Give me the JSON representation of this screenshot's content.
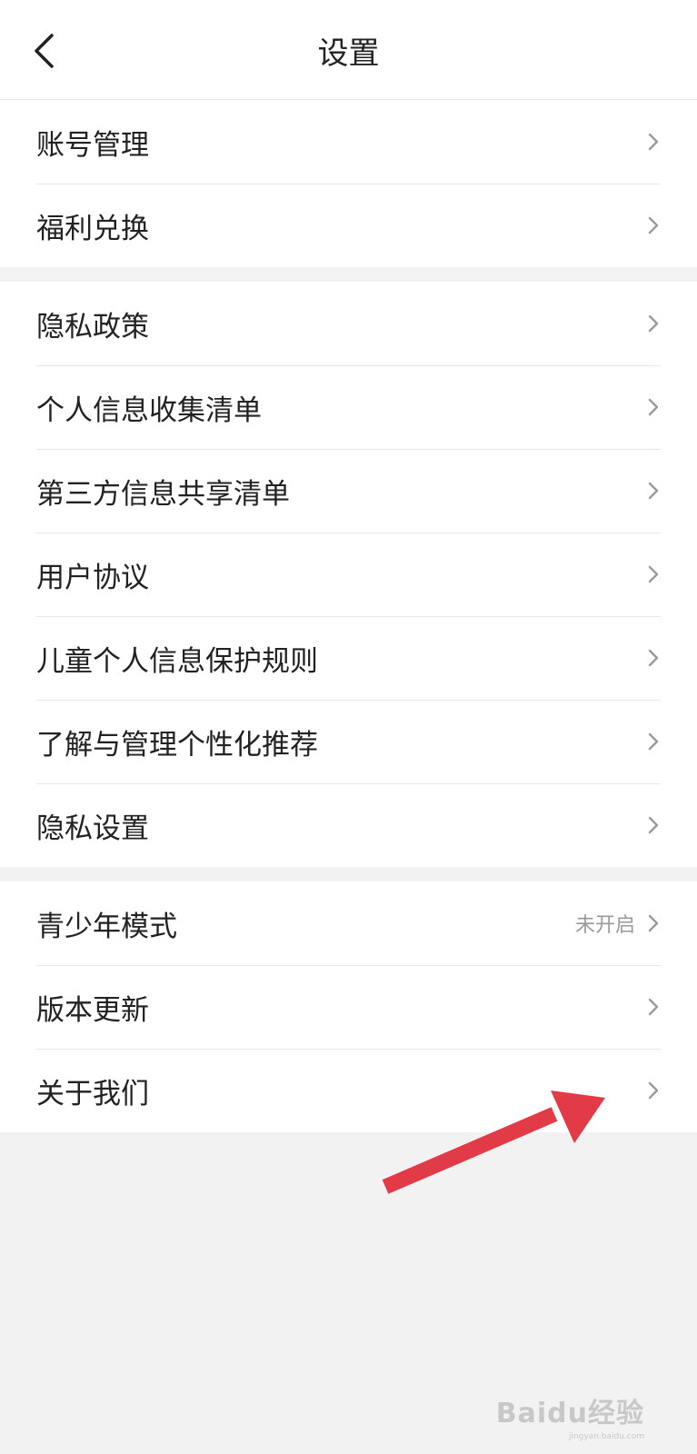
{
  "header": {
    "title": "设置"
  },
  "groups": [
    {
      "items": [
        {
          "label": "账号管理"
        },
        {
          "label": "福利兑换"
        }
      ]
    },
    {
      "items": [
        {
          "label": "隐私政策"
        },
        {
          "label": "个人信息收集清单"
        },
        {
          "label": "第三方信息共享清单"
        },
        {
          "label": "用户协议"
        },
        {
          "label": "儿童个人信息保护规则"
        },
        {
          "label": "了解与管理个性化推荐"
        },
        {
          "label": "隐私设置"
        }
      ]
    },
    {
      "items": [
        {
          "label": "青少年模式",
          "status": "未开启"
        },
        {
          "label": "版本更新"
        },
        {
          "label": "关于我们"
        }
      ]
    }
  ],
  "annotation": {
    "arrow_color": "#e23a46"
  },
  "watermark": {
    "logo": "Baidu经验",
    "sub": "jingyan.baidu.com"
  }
}
